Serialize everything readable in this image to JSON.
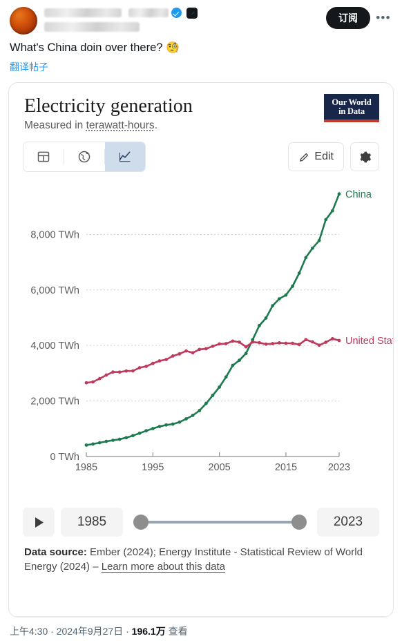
{
  "post": {
    "author_name_redacted": true,
    "verified_icon": "verified-badge-icon",
    "affiliate_badge_icon": "affiliate-badge-icon",
    "subscribe_label": "订阅",
    "more_label": "•••",
    "text": "What's China doin over there?",
    "emoji": "🧐",
    "translate_label": "翻译帖子",
    "footer_time": "上午4:30",
    "footer_sep1": "·",
    "footer_date": "2024年9月27日",
    "footer_sep2": "·",
    "footer_views": "196.1万",
    "footer_views_label": "查看"
  },
  "chart": {
    "title": "Electricity generation",
    "subtitle_prefix": "Measured in ",
    "subtitle_underlined": "terawatt-hours",
    "subtitle_suffix": ".",
    "logo_line1": "Our World",
    "logo_line2": "in Data",
    "tabs": [
      {
        "name": "table",
        "icon": "table-icon",
        "active": false
      },
      {
        "name": "map",
        "icon": "globe-icon",
        "active": false
      },
      {
        "name": "chart",
        "icon": "line-chart-icon",
        "active": true
      }
    ],
    "edit_label": "Edit",
    "edit_icon": "pencil-icon",
    "settings_icon": "gear-icon",
    "timeline": {
      "play_icon": "play-icon",
      "start_year": "1985",
      "end_year": "2023"
    },
    "source_label": "Data source:",
    "source_text": " Ember (2024); Energy Institute - Statistical Review of World Energy (2024) – ",
    "source_link": "Learn more about this data"
  },
  "chart_data": {
    "type": "line",
    "title": "Electricity generation",
    "subtitle": "Measured in terawatt-hours.",
    "xlabel": "",
    "ylabel": "TWh",
    "xlim": [
      1985,
      2023
    ],
    "ylim": [
      0,
      9800
    ],
    "grid": true,
    "legend_position": "right-inline-labels",
    "ytick_labels": [
      "0 TWh",
      "2,000 TWh",
      "4,000 TWh",
      "6,000 TWh",
      "8,000 TWh"
    ],
    "ytick_values": [
      0,
      2000,
      4000,
      6000,
      8000
    ],
    "xtick_labels": [
      "1985",
      "1995",
      "2005",
      "2015",
      "2023"
    ],
    "xtick_values": [
      1985,
      1995,
      2005,
      2015,
      2023
    ],
    "x": [
      1985,
      1986,
      1987,
      1988,
      1989,
      1990,
      1991,
      1992,
      1993,
      1994,
      1995,
      1996,
      1997,
      1998,
      1999,
      2000,
      2001,
      2002,
      2003,
      2004,
      2005,
      2006,
      2007,
      2008,
      2009,
      2010,
      2011,
      2012,
      2013,
      2014,
      2015,
      2016,
      2017,
      2018,
      2019,
      2020,
      2021,
      2022,
      2023
    ],
    "series": [
      {
        "name": "China",
        "color": "#1d7a4e",
        "label_color": "#1d7a4e",
        "values": [
          411,
          450,
          497,
          545,
          585,
          621,
          678,
          754,
          839,
          928,
          1007,
          1081,
          1136,
          1167,
          1239,
          1356,
          1481,
          1654,
          1911,
          2203,
          2500,
          2866,
          3282,
          3466,
          3715,
          4208,
          4715,
          4988,
          5432,
          5680,
          5815,
          6133,
          6604,
          7166,
          7503,
          7779,
          8534,
          8849,
          9456
        ]
      },
      {
        "name": "United States",
        "color": "#bc3b5c",
        "label_color": "#bc3b5c",
        "values": [
          2656,
          2687,
          2806,
          2933,
          3043,
          3041,
          3079,
          3084,
          3197,
          3248,
          3353,
          3444,
          3492,
          3620,
          3695,
          3802,
          3737,
          3858,
          3883,
          3971,
          4055,
          4065,
          4157,
          4119,
          3950,
          4125,
          4100,
          4048,
          4066,
          4094,
          4078,
          4077,
          4034,
          4209,
          4127,
          4009,
          4116,
          4243,
          4178
        ]
      }
    ]
  }
}
